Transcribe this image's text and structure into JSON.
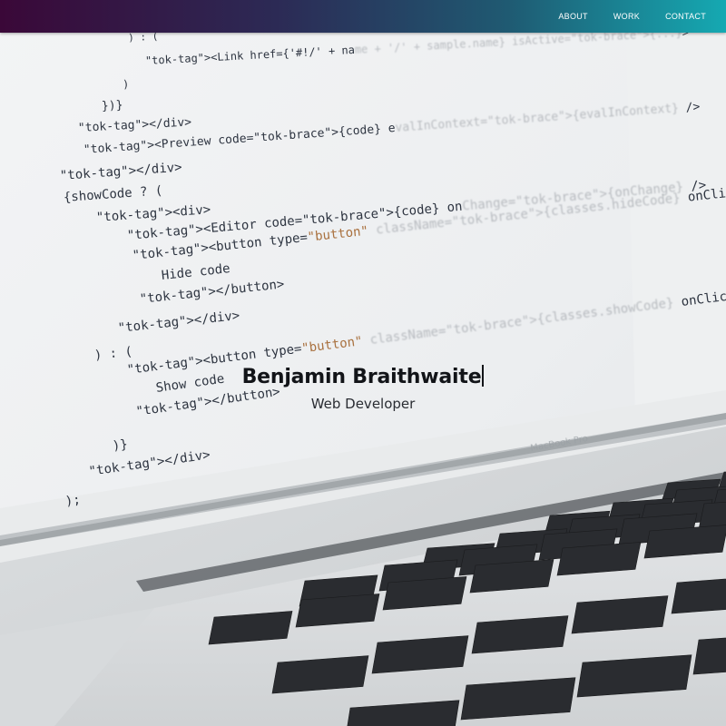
{
  "nav": {
    "links": [
      {
        "label": "ABOUT"
      },
      {
        "label": "WORK"
      },
      {
        "label": "CONTACT"
      }
    ]
  },
  "hero": {
    "name": "Benjamin Braithwaite",
    "role": "Web Developer"
  },
  "background": {
    "laptop_brand": "MacBook Pro",
    "code_lines": [
      "  ) : (",
      "<Link href={'#!/' + name + '/' + sample.name} isActive={...}>",
      ")",
      "})}",
      "</div>",
      "<Preview code={code} evalInContext={evalInContext} />",
      "</div>",
      "{showCode ? (",
      "<div>",
      "<Editor code={code} onChange={onChange} />",
      "<button type=\"button\" className={classes.hideCode} onClick={this.toggleCode}>",
      "Hide code",
      "</button>",
      "</div>",
      ") : (",
      "<button type=\"button\" className={classes.showCode} onClick={this.toggleCode}>",
      "Show code",
      "</button>",
      ")}",
      "</div>",
      ");"
    ]
  },
  "colors": {
    "nav_gradient_start": "#3a0838",
    "nav_gradient_end": "#15a9b2",
    "name_text": "#121418"
  }
}
